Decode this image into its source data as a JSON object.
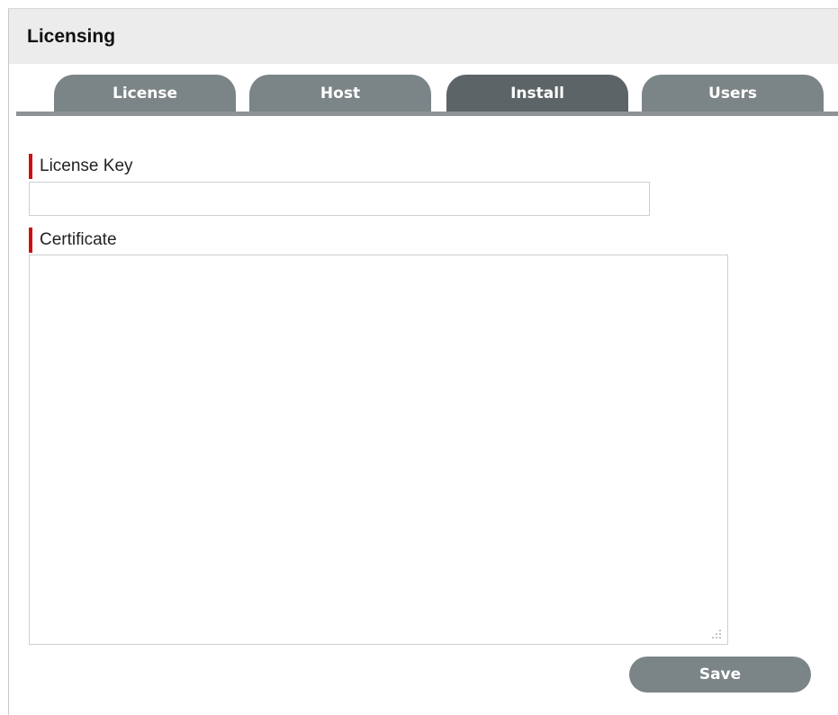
{
  "panel": {
    "title": "Licensing"
  },
  "tabs": [
    {
      "label": "License",
      "active": false
    },
    {
      "label": "Host",
      "active": false
    },
    {
      "label": "Install",
      "active": true
    },
    {
      "label": "Users",
      "active": false
    }
  ],
  "form": {
    "license_key": {
      "label": "License Key",
      "value": "",
      "required": true
    },
    "certificate": {
      "label": "Certificate",
      "value": "",
      "required": true
    },
    "save_label": "Save"
  },
  "colors": {
    "tab_inactive": "#7b8487",
    "tab_active": "#5c6467",
    "required_marker": "#cc1010",
    "header_bg": "#ececec"
  }
}
